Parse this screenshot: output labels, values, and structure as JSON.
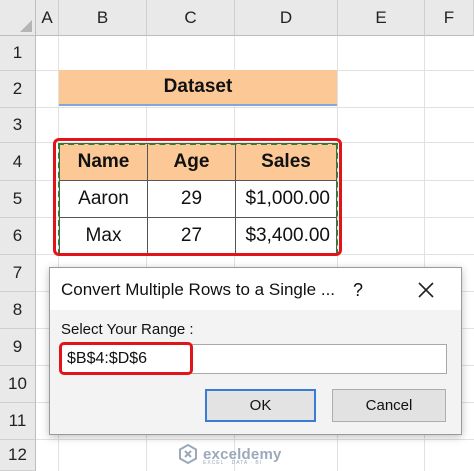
{
  "columns": [
    "A",
    "B",
    "C",
    "D",
    "E",
    "F"
  ],
  "rows": [
    "1",
    "2",
    "3",
    "4",
    "5",
    "6",
    "7",
    "8",
    "9",
    "10",
    "11",
    "12"
  ],
  "dataset_title": "Dataset",
  "table": {
    "headers": [
      "Name",
      "Age",
      "Sales"
    ],
    "rows": [
      [
        "Aaron",
        "29",
        "$1,000.00"
      ],
      [
        "Max",
        "27",
        "$3,400.00"
      ]
    ]
  },
  "dialog": {
    "title": "Convert Multiple Rows to a Single ...",
    "help": "?",
    "label": "Select Your Range :",
    "input_value": "$B$4:$D$6",
    "ok_label": "OK",
    "cancel_label": "Cancel"
  },
  "colors": {
    "header_fill": "#fbc896",
    "highlight": "#e2141b",
    "marching_ants": "#2e7d32"
  },
  "watermark": {
    "name": "exceldemy",
    "tagline": "EXCEL · DATA · BI"
  }
}
